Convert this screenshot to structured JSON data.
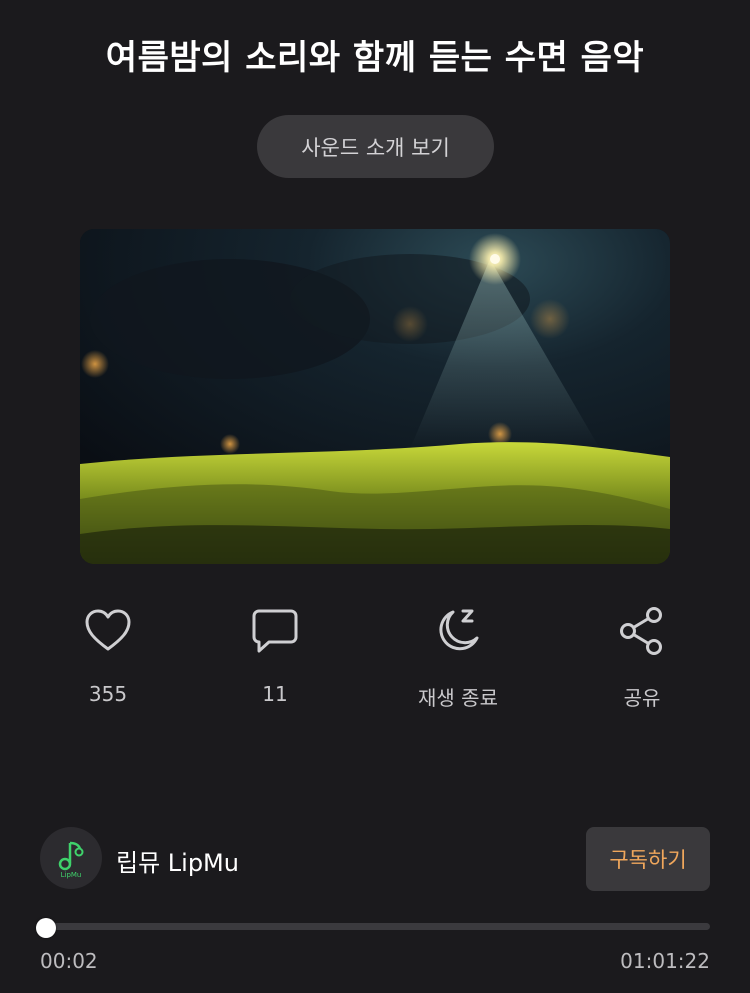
{
  "header": {
    "title": "여름밤의 소리와 함께 듣는 수면 음악",
    "intro_button_label": "사운드 소개 보기"
  },
  "actions": [
    {
      "icon": "heart-icon",
      "label": "355"
    },
    {
      "icon": "comment-icon",
      "label": "11"
    },
    {
      "icon": "sleep-timer-icon",
      "label": "재생 종료"
    },
    {
      "icon": "share-icon",
      "label": "공유"
    }
  ],
  "channel": {
    "avatar_icon": "lipmu-logo",
    "name": "립뮤 LipMu",
    "subscribe_label": "구독하기"
  },
  "player": {
    "current_time": "00:02",
    "total_time": "01:01:22",
    "progress_fraction": 0.0005
  },
  "colors": {
    "background": "#1b1a1d",
    "button_bg": "#3a393c",
    "subscribe_text": "#f0a75c",
    "logo_green": "#3fd26b"
  }
}
